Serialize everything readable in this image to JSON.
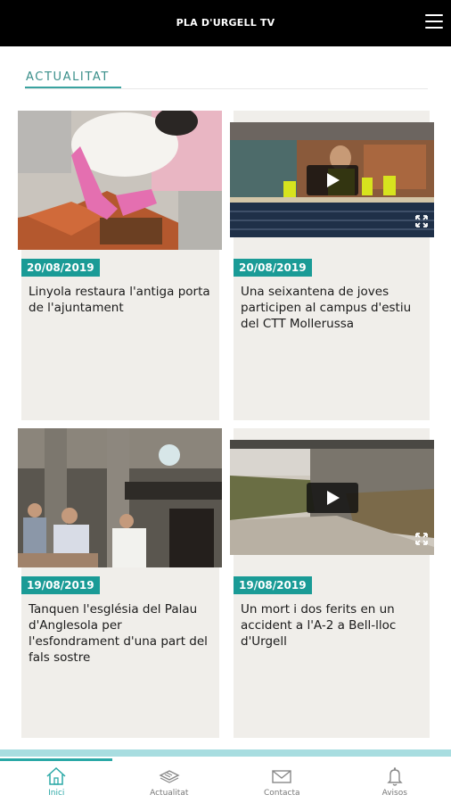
{
  "header": {
    "title": "PLA D'URGELL TV"
  },
  "section": {
    "title": "ACTUALITAT"
  },
  "articles": [
    {
      "date": "20/08/2019",
      "title": "Linyola restaura l'antiga porta de l'ajuntament",
      "media": "image"
    },
    {
      "date": "20/08/2019",
      "title": "Una seixantena de joves participen al campus d'estiu del CTT Mollerussa",
      "media": "video"
    },
    {
      "date": "19/08/2019",
      "title": "Tanquen l'església del Palau d'Anglesola per l'esfondrament d'una part del fals sostre",
      "media": "image"
    },
    {
      "date": "19/08/2019",
      "title": "Un mort i dos ferits en un accident a l'A-2 a Bell-lloc d'Urgell",
      "media": "video"
    }
  ],
  "nav": [
    {
      "label": "Inici",
      "icon": "home-icon",
      "active": true
    },
    {
      "label": "Actualitat",
      "icon": "newspaper-icon",
      "active": false
    },
    {
      "label": "Contacta",
      "icon": "mail-icon",
      "active": false
    },
    {
      "label": "Avisos",
      "icon": "bell-icon",
      "active": false
    }
  ],
  "colors": {
    "accent": "#1a9b96",
    "header": "#000000",
    "card": "#f0eeea"
  }
}
